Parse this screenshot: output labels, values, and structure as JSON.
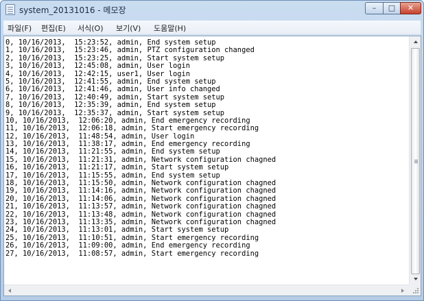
{
  "window": {
    "title": "system_20131016 - 메모장",
    "controls": {
      "minimize": "–",
      "maximize": "□",
      "close": "✕"
    }
  },
  "menu": [
    {
      "label": "파일(F)"
    },
    {
      "label": "편집(E)"
    },
    {
      "label": "서식(O)"
    },
    {
      "label": "보기(V)"
    },
    {
      "label": "도움말(H)"
    }
  ],
  "lines": [
    "0, 10/16/2013,  15:23:52, admin, End system setup",
    "1, 10/16/2013,  15:23:46, admin, PTZ configuration changed",
    "2, 10/16/2013,  15:23:25, admin, Start system setup",
    "3, 10/16/2013,  12:45:08, admin, User login",
    "4, 10/16/2013,  12:42:15, user1, User login",
    "5, 10/16/2013,  12:41:55, admin, End system setup",
    "6, 10/16/2013,  12:41:46, admin, User info changed",
    "7, 10/16/2013,  12:40:49, admin, Start system setup",
    "8, 10/16/2013,  12:35:39, admin, End system setup",
    "9, 10/16/2013,  12:35:37, admin, Start system setup",
    "10, 10/16/2013,  12:06:20, admin, End emergency recording",
    "11, 10/16/2013,  12:06:18, admin, Start emergency recording",
    "12, 10/16/2013,  11:48:54, admin, User login",
    "13, 10/16/2013,  11:38:17, admin, End emergency recording",
    "14, 10/16/2013,  11:21:55, admin, End system setup",
    "15, 10/16/2013,  11:21:31, admin, Network configuration chagned",
    "16, 10/16/2013,  11:21:17, admin, Start system setup",
    "17, 10/16/2013,  11:15:55, admin, End system setup",
    "18, 10/16/2013,  11:15:50, admin, Network configuration chagned",
    "19, 10/16/2013,  11:14:16, admin, Network configuration chagned",
    "20, 10/16/2013,  11:14:06, admin, Network configuration chagned",
    "21, 10/16/2013,  11:13:57, admin, Network configuration chagned",
    "22, 10/16/2013,  11:13:48, admin, Network configuration chagned",
    "23, 10/16/2013,  11:13:35, admin, Network configuration chagned",
    "24, 10/16/2013,  11:13:01, admin, Start system setup",
    "25, 10/16/2013,  11:10:51, admin, Start emergency recording",
    "26, 10/16/2013,  11:09:00, admin, End emergency recording",
    "27, 10/16/2013,  11:08:57, admin, Start emergency recording"
  ],
  "icons": {
    "app": "notepad-icon",
    "scroll_up": "scroll-up-arrow-icon",
    "scroll_down": "scroll-down-arrow-icon",
    "scroll_left": "scroll-left-arrow-icon",
    "scroll_right": "scroll-right-arrow-icon"
  }
}
